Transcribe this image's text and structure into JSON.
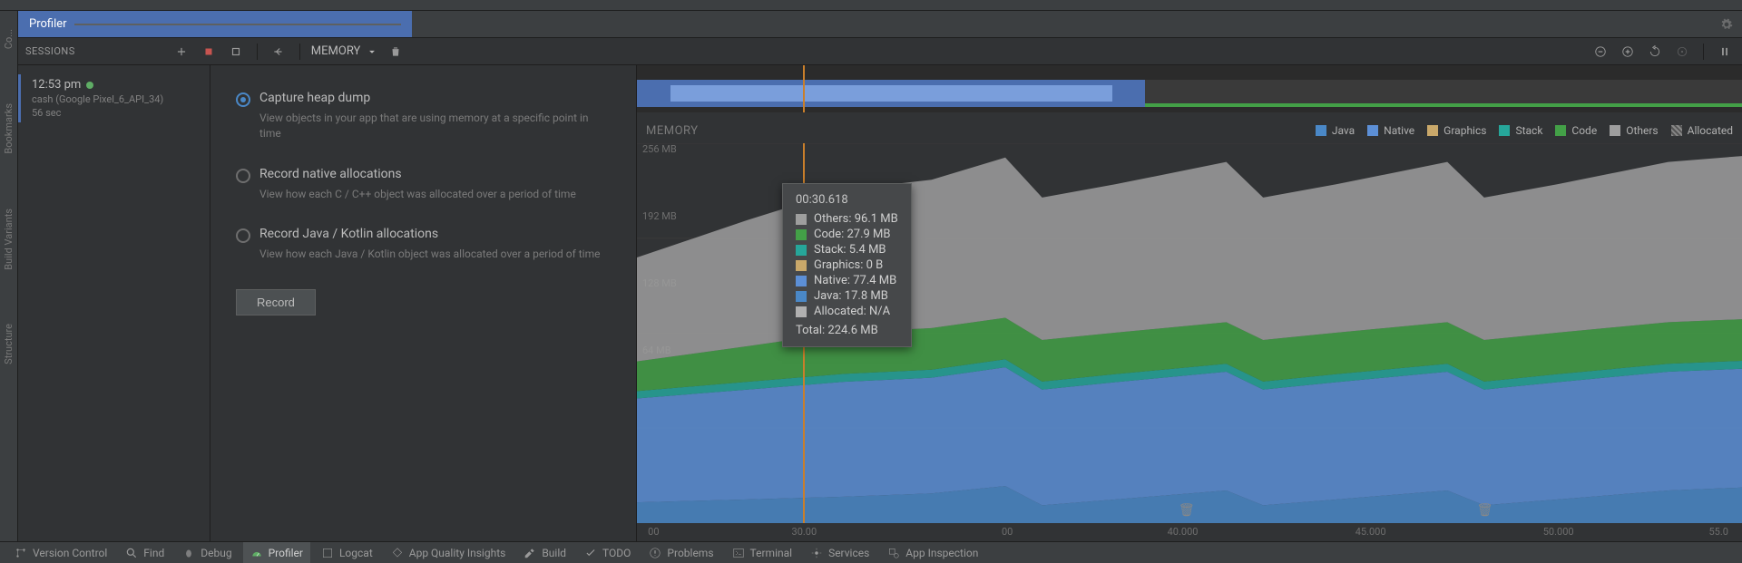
{
  "left_rail": {
    "bookmarks": "Bookmarks",
    "build_variants": "Build Variants",
    "structure": "Structure",
    "top": "Co..."
  },
  "tab": {
    "profiler": "Profiler"
  },
  "sessions": {
    "label": "SESSIONS",
    "item": {
      "time": "12:53 pm",
      "device": "cash (Google Pixel_6_API_34)",
      "duration": "56 sec"
    }
  },
  "toolbar": {
    "memory": "MEMORY"
  },
  "options": {
    "heap_dump": {
      "title": "Capture heap dump",
      "desc": "View objects in your app that are using memory at a specific point in time"
    },
    "native_alloc": {
      "title": "Record native allocations",
      "desc": "View how each C / C++ object was allocated over a period of time"
    },
    "java_alloc": {
      "title": "Record Java / Kotlin allocations",
      "desc": "View how each Java / Kotlin object was allocated over a period of time"
    },
    "record_btn": "Record"
  },
  "chart": {
    "title": "MEMORY",
    "legend": {
      "java": "Java",
      "native": "Native",
      "graphics": "Graphics",
      "stack": "Stack",
      "code": "Code",
      "others": "Others",
      "allocated": "Allocated"
    },
    "y_ticks": [
      "256 MB",
      "192 MB",
      "128 MB",
      "64 MB"
    ],
    "x_ticks": [
      "00",
      "30.00",
      "00",
      "40.000",
      "45.000",
      "50.000",
      "55.0"
    ]
  },
  "tooltip": {
    "time": "00:30.618",
    "rows": [
      {
        "label": "Others",
        "value": "96.1 MB",
        "color": "#9e9e9e"
      },
      {
        "label": "Code",
        "value": "27.9 MB",
        "color": "#43a047"
      },
      {
        "label": "Stack",
        "value": "5.4 MB",
        "color": "#26a69a"
      },
      {
        "label": "Graphics",
        "value": "0 B",
        "color": "#c9a86a"
      },
      {
        "label": "Native",
        "value": "77.4 MB",
        "color": "#5c8fd6"
      },
      {
        "label": "Java",
        "value": "17.8 MB",
        "color": "#4a88c7"
      },
      {
        "label": "Allocated",
        "value": "N/A",
        "color": "#b0b0b0"
      }
    ],
    "total": "Total: 224.6 MB"
  },
  "colors": {
    "java": "#4a88c7",
    "native": "#5c8fd6",
    "graphics": "#c9a86a",
    "stack": "#26a69a",
    "code": "#43a047",
    "others": "#9e9e9e",
    "allocated": "#b0b0b0"
  },
  "chart_data": {
    "type": "area",
    "title": "MEMORY",
    "ylabel": "MB",
    "ylim": [
      0,
      256
    ],
    "x_range_seconds": [
      25,
      55
    ],
    "playhead_seconds": 30.618,
    "series_order_bottom_to_top": [
      "java",
      "native",
      "graphics",
      "stack",
      "code",
      "others"
    ],
    "x_seconds": [
      25,
      28,
      30.618,
      33,
      35,
      36,
      38,
      41,
      42,
      44,
      47,
      48,
      50,
      53,
      55
    ],
    "series": [
      {
        "name": "Java",
        "color": "#4a88c7",
        "values_mb": [
          14,
          16,
          17.8,
          20,
          25,
          12,
          16,
          22,
          12,
          16,
          22,
          12,
          16,
          22,
          24
        ]
      },
      {
        "name": "Native",
        "color": "#5c8fd6",
        "values_mb": [
          70,
          74,
          77.4,
          78,
          80,
          78,
          79,
          80,
          78,
          79,
          80,
          78,
          79,
          80,
          80
        ]
      },
      {
        "name": "Graphics",
        "color": "#c9a86a",
        "values_mb": [
          0,
          0,
          0,
          0,
          0,
          0,
          0,
          0,
          0,
          0,
          0,
          0,
          0,
          0,
          0
        ]
      },
      {
        "name": "Stack",
        "color": "#26a69a",
        "values_mb": [
          5,
          5.2,
          5.4,
          5.4,
          5.4,
          5.4,
          5.4,
          5.4,
          5.4,
          5.4,
          5.4,
          5.4,
          5.4,
          5.4,
          5.4
        ]
      },
      {
        "name": "Code",
        "color": "#43a047",
        "values_mb": [
          20,
          24,
          27.9,
          28,
          28,
          28,
          28,
          28,
          28,
          28,
          28,
          28,
          28,
          28,
          28
        ]
      },
      {
        "name": "Others",
        "color": "#9e9e9e",
        "values_mb": [
          70,
          85,
          96.1,
          100,
          108,
          96,
          100,
          108,
          96,
          100,
          108,
          96,
          100,
          108,
          110
        ]
      }
    ],
    "gc_markers_seconds": [
      41.5,
      48.0
    ]
  },
  "bottom_bar": {
    "version_control": "Version Control",
    "find": "Find",
    "debug": "Debug",
    "profiler": "Profiler",
    "logcat": "Logcat",
    "app_quality": "App Quality Insights",
    "build": "Build",
    "todo": "TODO",
    "problems": "Problems",
    "terminal": "Terminal",
    "services": "Services",
    "app_inspection": "App Inspection"
  }
}
